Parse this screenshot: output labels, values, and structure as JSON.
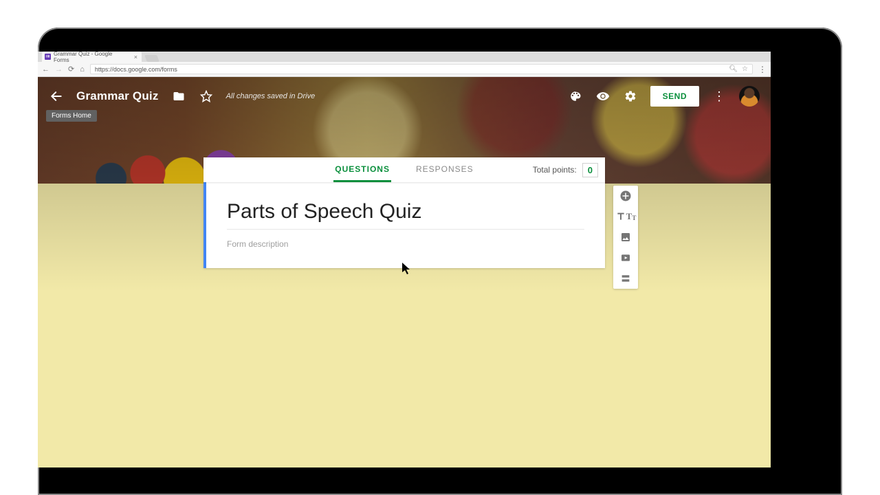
{
  "browser": {
    "tab_title": "Grammar Quiz - Google Forms",
    "url": "https://docs.google.com/forms"
  },
  "appbar": {
    "tooltip": "Forms Home",
    "title": "Grammar Quiz",
    "save_status": "All changes saved in Drive",
    "send_label": "SEND"
  },
  "tabs": {
    "questions": "QUESTIONS",
    "responses": "RESPONSES",
    "points_label": "Total points:",
    "points_value": "0"
  },
  "form": {
    "title": "Parts of Speech Quiz",
    "description_placeholder": "Form description"
  },
  "tools": {
    "add_question": "add-question",
    "add_title": "add-title-description",
    "add_image": "add-image",
    "add_video": "add-video",
    "add_section": "add-section"
  }
}
